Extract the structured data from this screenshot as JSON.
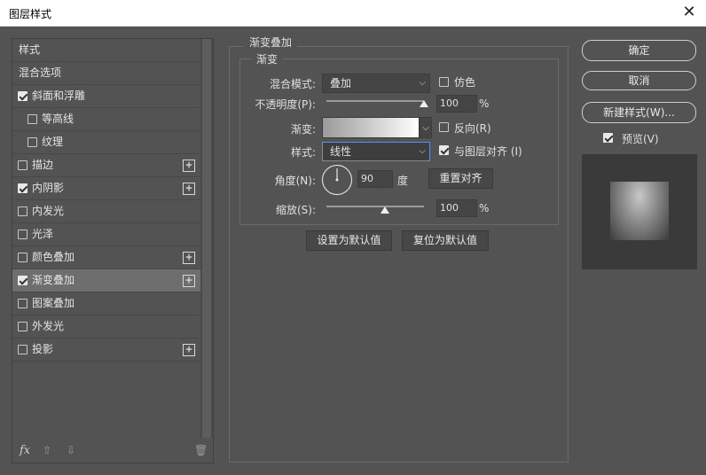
{
  "window": {
    "title": "图层样式",
    "close_glyph": "✕"
  },
  "sidebar": {
    "items": [
      {
        "label": "样式",
        "checkbox": false,
        "checked": false,
        "plus": false,
        "indent": false,
        "selected": false
      },
      {
        "label": "混合选项",
        "checkbox": false,
        "checked": false,
        "plus": false,
        "indent": false,
        "selected": false
      },
      {
        "label": "斜面和浮雕",
        "checkbox": true,
        "checked": true,
        "plus": false,
        "indent": false,
        "selected": false
      },
      {
        "label": "等高线",
        "checkbox": true,
        "checked": false,
        "plus": false,
        "indent": true,
        "selected": false
      },
      {
        "label": "纹理",
        "checkbox": true,
        "checked": false,
        "plus": false,
        "indent": true,
        "selected": false
      },
      {
        "label": "描边",
        "checkbox": true,
        "checked": false,
        "plus": true,
        "indent": false,
        "selected": false
      },
      {
        "label": "内阴影",
        "checkbox": true,
        "checked": true,
        "plus": true,
        "indent": false,
        "selected": false
      },
      {
        "label": "内发光",
        "checkbox": true,
        "checked": false,
        "plus": false,
        "indent": false,
        "selected": false
      },
      {
        "label": "光泽",
        "checkbox": true,
        "checked": false,
        "plus": false,
        "indent": false,
        "selected": false
      },
      {
        "label": "颜色叠加",
        "checkbox": true,
        "checked": false,
        "plus": true,
        "indent": false,
        "selected": false
      },
      {
        "label": "渐变叠加",
        "checkbox": true,
        "checked": true,
        "plus": true,
        "indent": false,
        "selected": true
      },
      {
        "label": "图案叠加",
        "checkbox": true,
        "checked": false,
        "plus": false,
        "indent": false,
        "selected": false
      },
      {
        "label": "外发光",
        "checkbox": true,
        "checked": false,
        "plus": false,
        "indent": false,
        "selected": false
      },
      {
        "label": "投影",
        "checkbox": true,
        "checked": false,
        "plus": true,
        "indent": false,
        "selected": false
      }
    ],
    "plus_glyph": "+",
    "footer": {
      "fx": "fx",
      "up_glyph": "⇧",
      "down_glyph": "⇩",
      "trash_glyph": "🗑"
    }
  },
  "panel": {
    "group_title": "渐变叠加",
    "subgroup_title": "渐变",
    "blend_mode_label": "混合模式:",
    "blend_mode_value": "叠加",
    "dither_label": "仿色",
    "dither_checked": false,
    "opacity_label": "不透明度(P):",
    "opacity_value": "100",
    "opacity_percent": 100,
    "percent_unit": "%",
    "gradient_label": "渐变:",
    "reverse_label": "反向(R)",
    "reverse_checked": false,
    "style_label": "样式:",
    "style_value": "线性",
    "align_label": "与图层对齐 (I)",
    "align_checked": true,
    "angle_label": "角度(N):",
    "angle_value": "90",
    "angle_unit": "度",
    "reset_align_button": "重置对齐",
    "scale_label": "缩放(S):",
    "scale_value": "100",
    "scale_percent": 100,
    "set_default_button": "设置为默认值",
    "reset_default_button": "复位为默认值",
    "dropdown_arrow": "⌵"
  },
  "actions": {
    "ok": "确定",
    "cancel": "取消",
    "new_style": "新建样式(W)...",
    "preview_label": "预览(V)",
    "preview_checked": true
  },
  "colors": {
    "background": "#535353",
    "selected_row": "#6e6e6e",
    "gradient_start": "#9a9a9a",
    "gradient_end": "#ffffff"
  }
}
